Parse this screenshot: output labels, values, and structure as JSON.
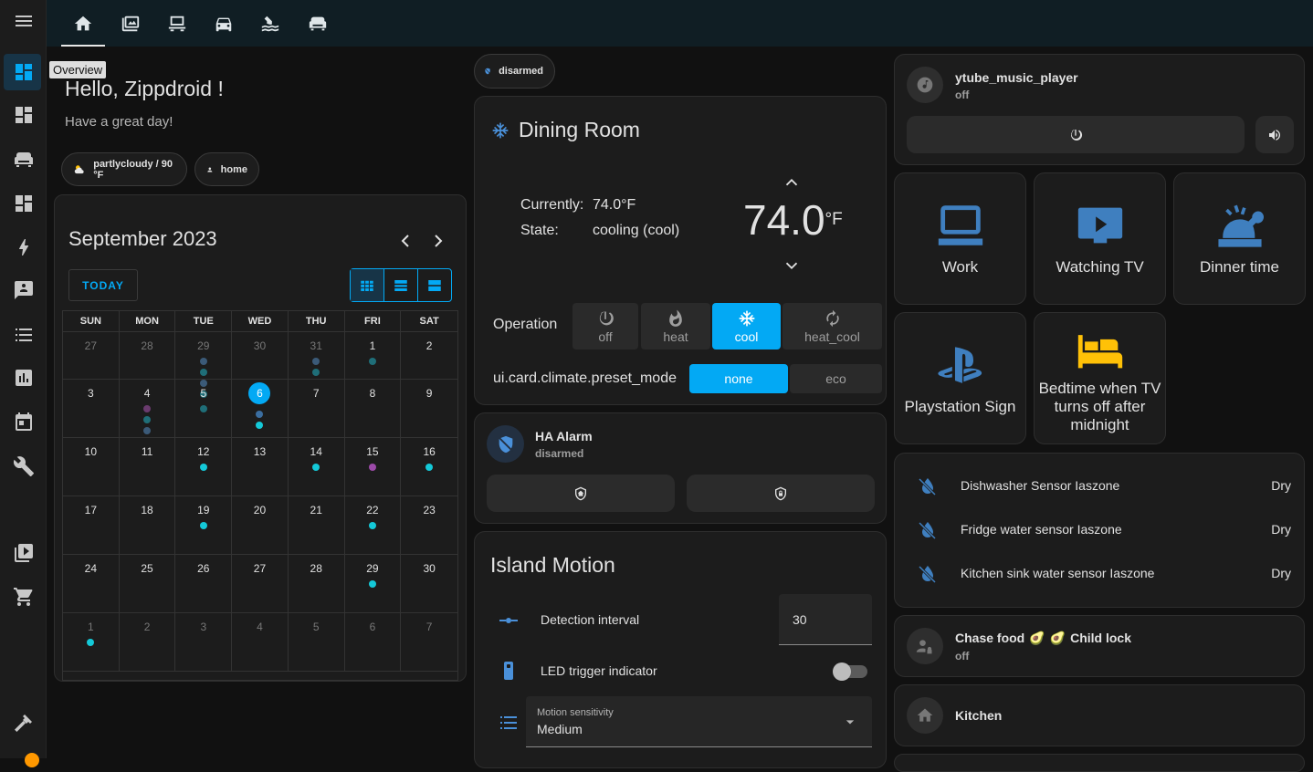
{
  "sidebar": {
    "tooltip": "Overview",
    "items": [
      "menu-icon",
      "overview-icon",
      "dashboard-icon",
      "sofa-icon",
      "dashboard-icon",
      "energy-icon",
      "chat-icon",
      "list-icon",
      "history-icon",
      "calendar-icon",
      "wrench-icon",
      "media-icon",
      "cart-icon",
      "hammer-icon"
    ]
  },
  "tabs": [
    "home-icon",
    "image-icon",
    "desk-icon",
    "car-icon",
    "pool-icon",
    "sofa-icon"
  ],
  "greeting": {
    "title": "Hello, Zippdroid !",
    "subtitle": "Have a great day!"
  },
  "chips": {
    "weather": "partlycloudy / 90 °F",
    "person": "home",
    "alarm": "disarmed"
  },
  "calendar": {
    "title": "September 2023",
    "today_label": "TODAY",
    "weekdays": [
      "SUN",
      "MON",
      "TUE",
      "WED",
      "THU",
      "FRI",
      "SAT"
    ],
    "rows": [
      [
        {
          "d": "27",
          "o": true
        },
        {
          "d": "28",
          "o": true
        },
        {
          "d": "29",
          "o": true,
          "dots": [
            "#3b5a78",
            "#1f6e78",
            "#3b5a78",
            "#1f6e78"
          ]
        },
        {
          "d": "30",
          "o": true
        },
        {
          "d": "31",
          "o": true,
          "dots": [
            "#3b5a78",
            "#1f6e78"
          ]
        },
        {
          "d": "1",
          "dots": [
            "#1f6e78"
          ]
        },
        {
          "d": "2"
        }
      ],
      [
        {
          "d": "3"
        },
        {
          "d": "4",
          "dots": [
            "#6a3b6e",
            "#1f6e78",
            "#3b5a78"
          ]
        },
        {
          "d": "5",
          "dots": [
            "#1f6e78"
          ]
        },
        {
          "d": "6",
          "today": true,
          "dots": [
            "#3b6ea0",
            "#14c9d8"
          ]
        },
        {
          "d": "7"
        },
        {
          "d": "8"
        },
        {
          "d": "9"
        }
      ],
      [
        {
          "d": "10"
        },
        {
          "d": "11"
        },
        {
          "d": "12",
          "dots": [
            "#14c9d8"
          ]
        },
        {
          "d": "13"
        },
        {
          "d": "14",
          "dots": [
            "#14c9d8"
          ]
        },
        {
          "d": "15",
          "dots": [
            "#9c4aa8"
          ]
        },
        {
          "d": "16",
          "dots": [
            "#14c9d8"
          ]
        }
      ],
      [
        {
          "d": "17"
        },
        {
          "d": "18"
        },
        {
          "d": "19",
          "dots": [
            "#14c9d8"
          ]
        },
        {
          "d": "20"
        },
        {
          "d": "21"
        },
        {
          "d": "22",
          "dots": [
            "#14c9d8"
          ]
        },
        {
          "d": "23"
        }
      ],
      [
        {
          "d": "24"
        },
        {
          "d": "25"
        },
        {
          "d": "26"
        },
        {
          "d": "27"
        },
        {
          "d": "28"
        },
        {
          "d": "29",
          "dots": [
            "#14c9d8"
          ]
        },
        {
          "d": "30"
        }
      ],
      [
        {
          "d": "1",
          "o": true,
          "dots": [
            "#14c9d8"
          ]
        },
        {
          "d": "2",
          "o": true
        },
        {
          "d": "3",
          "o": true
        },
        {
          "d": "4",
          "o": true
        },
        {
          "d": "5",
          "o": true
        },
        {
          "d": "6",
          "o": true
        },
        {
          "d": "7",
          "o": true
        }
      ]
    ]
  },
  "climate": {
    "name": "Dining Room",
    "currently_label": "Currently:",
    "currently_value": "74.0°F",
    "state_label": "State:",
    "state_value": "cooling (cool)",
    "target": "74.0",
    "unit": "°F",
    "operation_label": "Operation",
    "modes": [
      {
        "id": "off",
        "label": "off"
      },
      {
        "id": "heat",
        "label": "heat"
      },
      {
        "id": "cool",
        "label": "cool",
        "active": true
      },
      {
        "id": "heat_cool",
        "label": "heat_cool"
      }
    ],
    "preset_label": "ui.card.climate.preset_mode",
    "presets": [
      {
        "label": "none",
        "active": true
      },
      {
        "label": "eco"
      }
    ]
  },
  "alarm": {
    "name": "HA Alarm",
    "state": "disarmed"
  },
  "motion": {
    "title": "Island Motion",
    "interval_label": "Detection interval",
    "interval_value": "30",
    "led_label": "LED trigger indicator",
    "led_on": false,
    "sensitivity_label": "Motion sensitivity",
    "sensitivity_value": "Medium"
  },
  "media": {
    "name": "ytube_music_player",
    "state": "off"
  },
  "scenes": [
    {
      "label": "Work",
      "icon": "laptop-icon"
    },
    {
      "label": "Watching TV",
      "icon": "tv-icon"
    },
    {
      "label": "Dinner time",
      "icon": "turkey-icon"
    },
    {
      "label": "Playstation Sign",
      "icon": "playstation-icon"
    },
    {
      "label": "Bedtime when TV turns off after midnight",
      "icon": "bed-icon"
    }
  ],
  "sensors": [
    {
      "name": "Dishwasher Sensor Iaszone",
      "value": "Dry"
    },
    {
      "name": "Fridge water sensor Iaszone",
      "value": "Dry"
    },
    {
      "name": "Kitchen sink water sensor Iaszone",
      "value": "Dry"
    }
  ],
  "child_lock": {
    "name": "Chase food",
    "separator_emoji": "🥑",
    "name2": "Child lock",
    "state": "off"
  },
  "kitchen": {
    "name": "Kitchen"
  },
  "colors": {
    "accent": "#03a9f4",
    "icon_blue": "#3f7fbf",
    "bed_yellow": "#ffc107"
  }
}
